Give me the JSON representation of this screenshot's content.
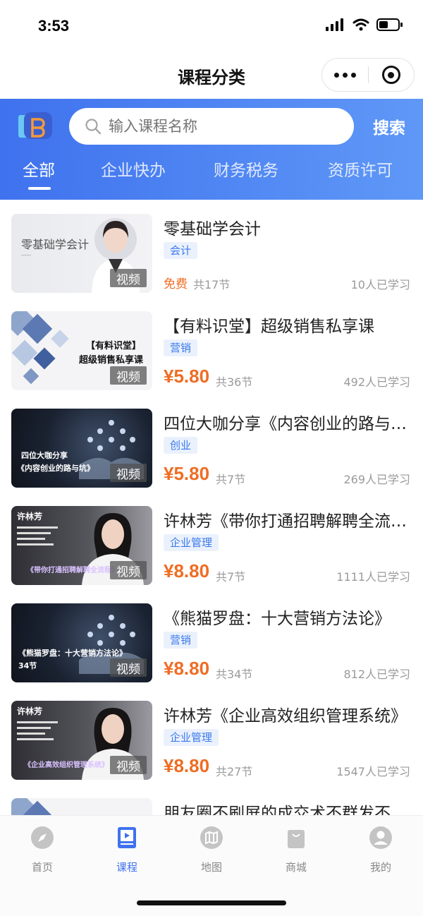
{
  "status_bar": {
    "time": "3:53"
  },
  "title_bar": {
    "title": "课程分类"
  },
  "search": {
    "placeholder": "输入课程名称",
    "button_label": "搜索"
  },
  "tabs": [
    {
      "label": "全部",
      "active": true
    },
    {
      "label": "企业快办",
      "active": false
    },
    {
      "label": "财务税务",
      "active": false
    },
    {
      "label": "资质许可",
      "active": false
    }
  ],
  "courses": [
    {
      "title": "零基础学会计",
      "tag": "会计",
      "price": "免费",
      "lessons": "共17节",
      "learned": "10人已学习",
      "thumb_text": [
        "零基础学会计"
      ],
      "badge": "视频"
    },
    {
      "title": "【有料识堂】超级销售私享课",
      "tag": "营销",
      "price": "¥5.80",
      "lessons": "共36节",
      "learned": "492人已学习",
      "thumb_text": [
        "【有料识堂】",
        "超级销售私享课"
      ],
      "badge": "视频"
    },
    {
      "title": "四位大咖分享《内容创业的路与坑》",
      "tag": "创业",
      "price": "¥5.80",
      "lessons": "共7节",
      "learned": "269人已学习",
      "thumb_text": [
        "四位大咖分享",
        "《内容创业的路与坑》"
      ],
      "badge": "视频"
    },
    {
      "title": "许林芳《带你打通招聘解聘全流程》",
      "tag": "企业管理",
      "price": "¥8.80",
      "lessons": "共7节",
      "learned": "1111人已学习",
      "thumb_text": [
        "许林芳",
        "《带你打通招聘解聘全流程》"
      ],
      "badge": "视频"
    },
    {
      "title": "《熊猫罗盘：十大营销方法论》",
      "tag": "营销",
      "price": "¥8.80",
      "lessons": "共34节",
      "learned": "812人已学习",
      "thumb_text": [
        "《熊猫罗盘：十大营销方法论》",
        "34节"
      ],
      "badge": "视频"
    },
    {
      "title": "许林芳《企业高效组织管理系统》",
      "tag": "企业管理",
      "price": "¥8.80",
      "lessons": "共27节",
      "learned": "1547人已学习",
      "thumb_text": [
        "许林芳",
        "《企业高效组织管理系统》"
      ],
      "badge": "视频"
    },
    {
      "title": "朋友圈不刷屏的成交术不群发不骚扰",
      "tag": "",
      "price": "",
      "lessons": "",
      "learned": "",
      "thumb_text": [],
      "badge": ""
    }
  ],
  "tab_bar": [
    {
      "label": "首页",
      "icon": "compass-icon",
      "active": false
    },
    {
      "label": "课程",
      "icon": "book-icon",
      "active": true
    },
    {
      "label": "地图",
      "icon": "map-icon",
      "active": false
    },
    {
      "label": "商城",
      "icon": "shopping-bag-icon",
      "active": false
    },
    {
      "label": "我的",
      "icon": "user-icon",
      "active": false
    }
  ],
  "colors": {
    "primary": "#3f72ee",
    "price": "#ef6d24",
    "tag_bg": "#eaf1fd",
    "tag_text": "#3b79ec"
  }
}
